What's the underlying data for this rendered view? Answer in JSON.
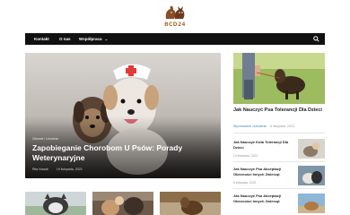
{
  "site": {
    "logo_text": "BCD24"
  },
  "nav": {
    "items": [
      "Kontakt",
      "O nas",
      "Współpraca"
    ],
    "dropdown_arrow": "⌄",
    "search_icon": "search-icon"
  },
  "hero": {
    "category": "Zdrowie i Leczenie",
    "title": "Zapobieganie Chorobom U Psów: Porady Weterynaryjne",
    "author": "Rita Nowak",
    "date": "19 listopada, 2023"
  },
  "sidebar": {
    "featured": {
      "title": "Jak Nauczyć Psa Tolerancji Dla Dzieci",
      "author": "Wychowanie i szkolenie",
      "date": "8 listopada, 2023"
    },
    "items": [
      {
        "title": "Jak Nauczyć Kota Tolerancji Dla Dzieci",
        "date": "10 listopada, 2023"
      },
      {
        "title": "Jak Nauczyć Psa Akceptacji Obecności Innych Zwierząt",
        "date": "8 listopada, 2023"
      },
      {
        "title": "Jak Nauczyć Psa Akceptacji Obecności Innych Zwierząt",
        "date": ""
      }
    ]
  },
  "colors": {
    "navbar": "#111111",
    "accent_link": "#3a86c8",
    "logo": "#b0703c"
  }
}
